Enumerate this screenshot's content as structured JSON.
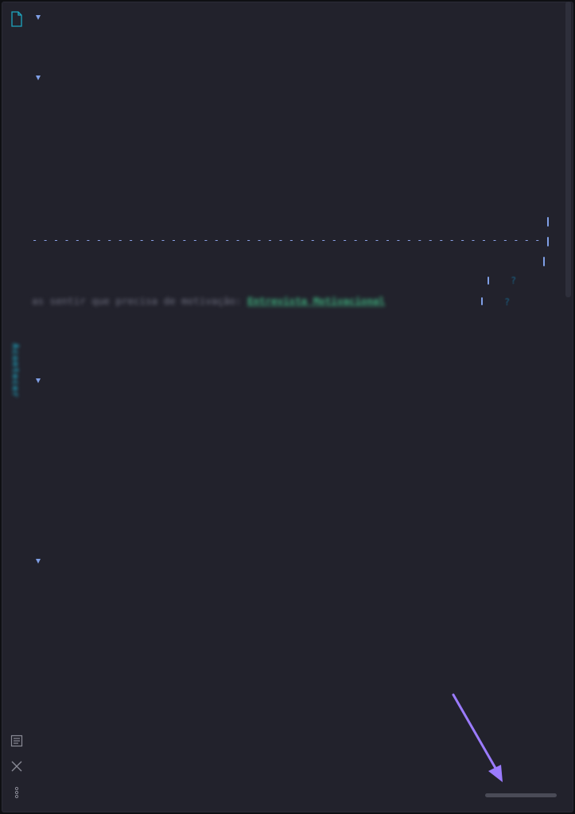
{
  "editor": {
    "blurred_line_text": "as sentir que precisa de motivação:",
    "link_text": "Entrevista Motivacional",
    "divider_text": "- - - - - - - - - - - - - - - - - - - - - - - - - - - - - - - - - - - - - - - - - - - - - - - - - - - - - - - - - - - - - - - - - -",
    "help_marker_1": "?",
    "help_marker_2": "?"
  },
  "sidebar": {
    "vertical_label": "Acontecer"
  },
  "icons": {
    "file": "file-icon",
    "outline": "outline-icon",
    "close": "close-icon",
    "more": "more-vertical-icon",
    "caret": "caret-down-icon"
  },
  "colors": {
    "background": "#22222c",
    "accent": "#1ea6c0",
    "caret": "#7f9fe6",
    "link": "#3fae7c",
    "annotation_arrow": "#9b7bff"
  }
}
